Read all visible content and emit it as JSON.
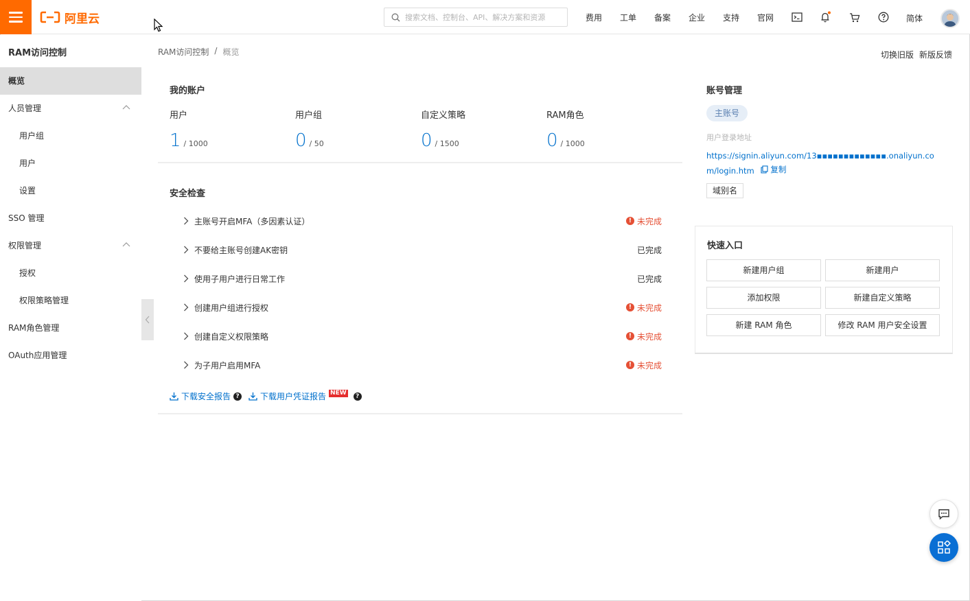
{
  "header": {
    "logo_text": "阿里云",
    "search_placeholder": "搜索文档、控制台、API、解决方案和资源",
    "nav": [
      "费用",
      "工单",
      "备案",
      "企业",
      "支持",
      "官网"
    ],
    "lang": "简体",
    "brand_color": "#ff6a00"
  },
  "sidebar": {
    "title": "RAM访问控制",
    "items": [
      {
        "label": "概览"
      },
      {
        "label": "人员管理"
      },
      {
        "label": "用户组"
      },
      {
        "label": "用户"
      },
      {
        "label": "设置"
      },
      {
        "label": "SSO 管理"
      },
      {
        "label": "权限管理"
      },
      {
        "label": "授权"
      },
      {
        "label": "权限策略管理"
      },
      {
        "label": "RAM角色管理"
      },
      {
        "label": "OAuth应用管理"
      }
    ]
  },
  "breadcrumb": {
    "root": "RAM访问控制",
    "sep": "/",
    "current": "概览"
  },
  "top_actions": {
    "old": "切换旧版",
    "feedback": "新版反馈"
  },
  "account": {
    "title": "我的账户",
    "stats": [
      {
        "name": "用户",
        "value": "1",
        "total": "/ 1000"
      },
      {
        "name": "用户组",
        "value": "0",
        "total": "/ 50"
      },
      {
        "name": "自定义策略",
        "value": "0",
        "total": "/ 1500"
      },
      {
        "name": "RAM角色",
        "value": "0",
        "total": "/ 1000"
      }
    ]
  },
  "security": {
    "title": "安全检查",
    "checks": [
      {
        "text": "主账号开启MFA（多因素认证）",
        "status": "未完成"
      },
      {
        "text": "不要给主账号创建AK密钥",
        "status": "已完成"
      },
      {
        "text": "使用子用户进行日常工作",
        "status": "已完成"
      },
      {
        "text": "创建用户组进行授权",
        "status": "未完成"
      },
      {
        "text": "创建自定义权限策略",
        "status": "未完成"
      },
      {
        "text": "为子用户启用MFA",
        "status": "未完成"
      }
    ],
    "download_report": "下载安全报告",
    "download_cred": "下载用户凭证报告",
    "new_badge": "NEW"
  },
  "account_mgmt": {
    "title": "账号管理",
    "tag": "主账号",
    "login_label": "用户登录地址",
    "login_url": "https://signin.aliyun.com/13▪▪▪▪▪▪▪▪▪▪▪▪▪.onaliyun.com/login.htm",
    "copy": "复制",
    "alias": "域别名"
  },
  "quick": {
    "title": "快速入口",
    "buttons": [
      "新建用户组",
      "新建用户",
      "添加权限",
      "新建自定义策略",
      "新建 RAM 角色",
      "修改 RAM 用户安全设置"
    ]
  }
}
